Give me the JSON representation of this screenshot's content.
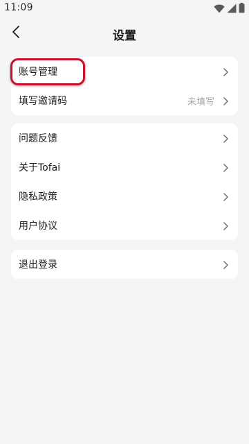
{
  "status_bar": {
    "time": "11:09",
    "icons": [
      "wifi-icon",
      "signal-icon",
      "battery-icon"
    ]
  },
  "nav": {
    "back_icon": "chevron-left-icon",
    "title": "设置"
  },
  "groups": [
    {
      "items": [
        {
          "label": "账号管理",
          "value": "",
          "highlighted": true
        },
        {
          "label": "填写邀请码",
          "value": "未填写"
        }
      ]
    },
    {
      "items": [
        {
          "label": "问题反馈",
          "value": ""
        },
        {
          "label": "关于Tofai",
          "value": ""
        },
        {
          "label": "隐私政策",
          "value": ""
        },
        {
          "label": "用户协议",
          "value": ""
        }
      ]
    },
    {
      "items": [
        {
          "label": "退出登录",
          "value": ""
        }
      ]
    }
  ],
  "colors": {
    "background": "#f4f5f7",
    "card": "#ffffff",
    "highlight": "#c8102e",
    "muted_text": "#a0a4ab",
    "chevron": "#6b6f76"
  }
}
